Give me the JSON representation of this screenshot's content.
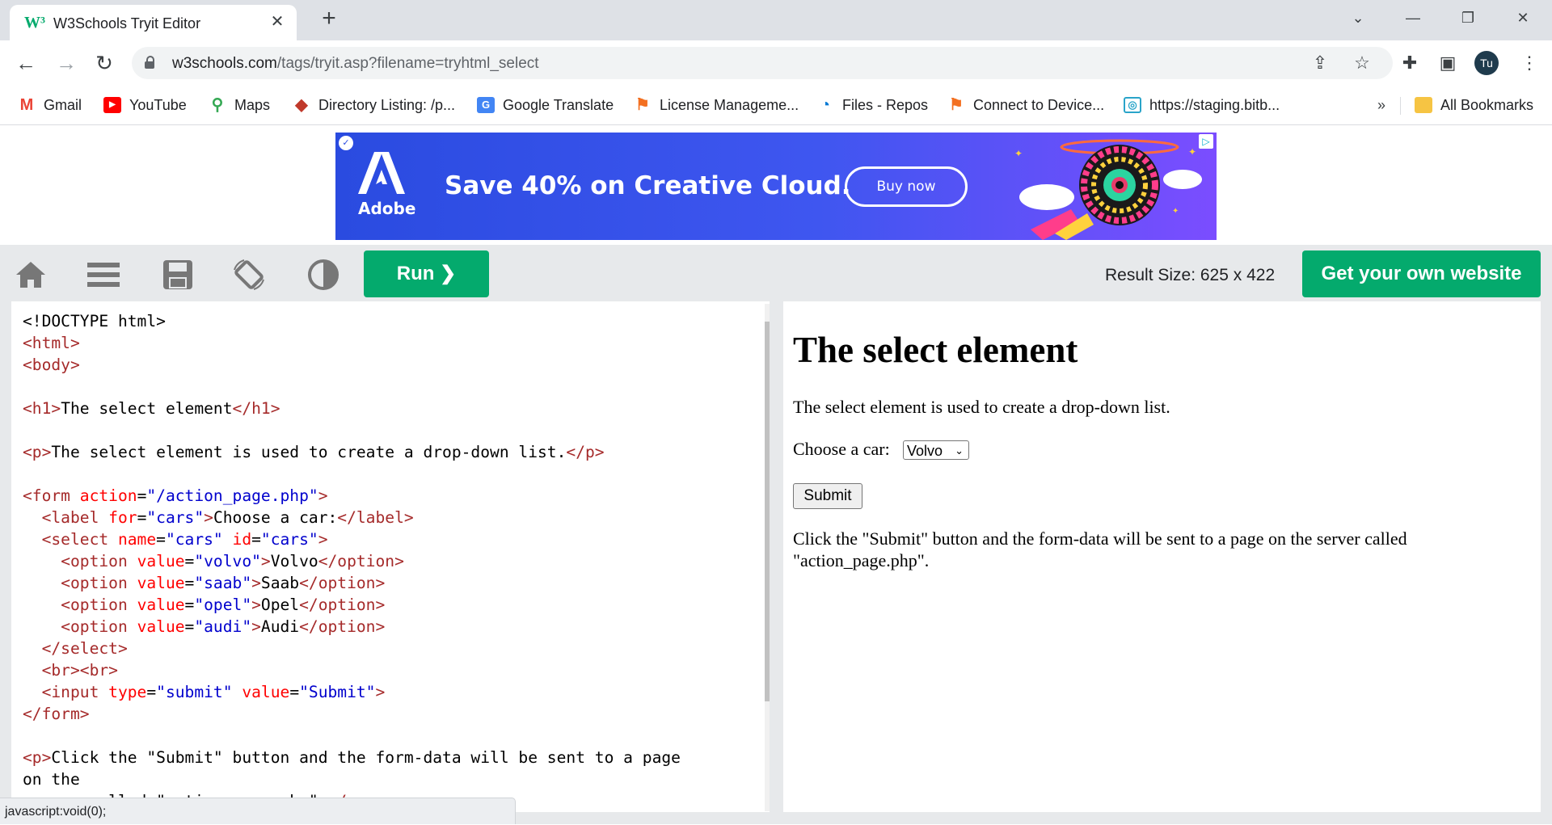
{
  "browser": {
    "tab_title": "W3Schools Tryit Editor",
    "tab_favicon": "W³",
    "url_host": "w3schools.com",
    "url_path": "/tags/tryit.asp?filename=tryhtml_select",
    "profile_initials": "Tu",
    "bookmarks": [
      {
        "label": "Gmail",
        "icon": "gmail-icon",
        "color": "#ea4335",
        "glyph": "M"
      },
      {
        "label": "YouTube",
        "icon": "youtube-icon",
        "color": "#ff0000",
        "glyph": "▶"
      },
      {
        "label": "Maps",
        "icon": "maps-icon",
        "color": "#34a853",
        "glyph": "●"
      },
      {
        "label": "Directory Listing: /p...",
        "icon": "directory-icon",
        "color": "#c0392b",
        "glyph": "◆"
      },
      {
        "label": "Google Translate",
        "icon": "translate-icon",
        "color": "#4285f4",
        "glyph": "G"
      },
      {
        "label": "License Manageme...",
        "icon": "license-icon",
        "color": "#f37021",
        "glyph": "⚑"
      },
      {
        "label": "Files - Repos",
        "icon": "files-icon",
        "color": "#0078d4",
        "glyph": "◔"
      },
      {
        "label": "Connect to Device...",
        "icon": "connect-icon",
        "color": "#f37021",
        "glyph": "⚑"
      },
      {
        "label": "https://staging.bitb...",
        "icon": "staging-icon",
        "color": "#2aa4c9",
        "glyph": "◎"
      }
    ],
    "bookmarks_overflow": "»",
    "all_bookmarks": "All Bookmarks"
  },
  "ad": {
    "brand": "Adobe",
    "headline": "Save 40% on Creative Cloud.",
    "cta": "Buy now"
  },
  "toolbar": {
    "run_label": "Run ❯",
    "result_size": "Result Size: 625 x 422",
    "own_website": "Get your own website"
  },
  "result": {
    "heading": "The select element",
    "intro": "The select element is used to create a drop-down list.",
    "label": "Choose a car:",
    "selected_option": "Volvo",
    "submit": "Submit",
    "note": "Click the \"Submit\" button and the form-data will be sent to a page on the server called \"action_page.php\"."
  },
  "status_text": "javascript:void(0);"
}
